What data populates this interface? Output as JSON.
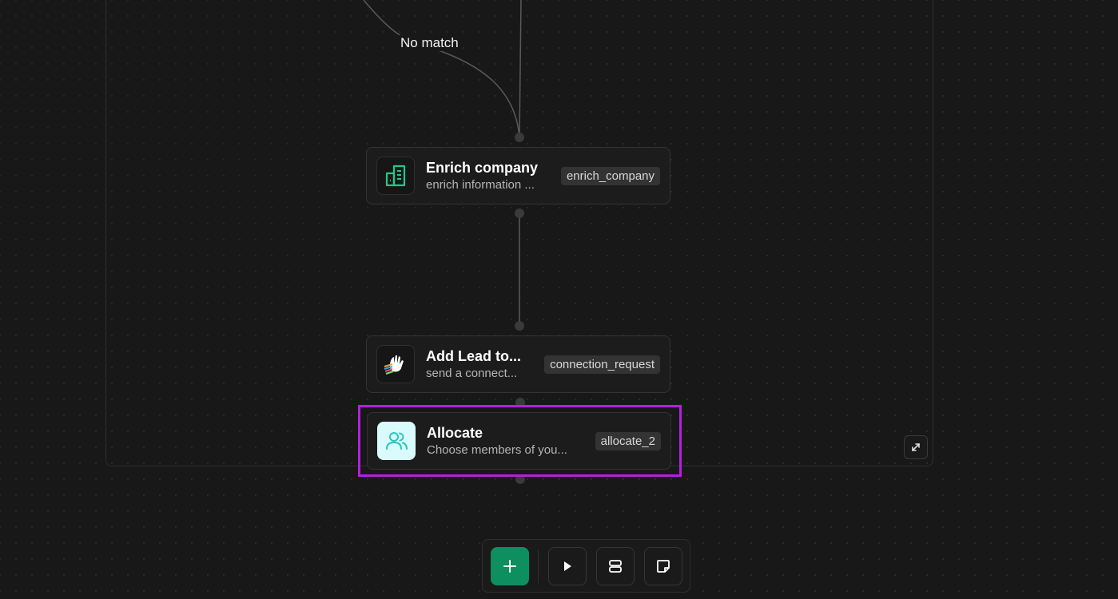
{
  "canvas": {
    "edge_label": "No match"
  },
  "nodes": [
    {
      "title": "Enrich company",
      "subtitle": "enrich information ...",
      "tag": "enrich_company",
      "icon": "building-icon"
    },
    {
      "title": "Add Lead to...",
      "subtitle": "send a connect...",
      "tag": "connection_request",
      "icon": "waving-hand-icon"
    },
    {
      "title": "Allocate",
      "subtitle": "Choose members of you...",
      "tag": "allocate_2",
      "icon": "users-icon",
      "selected": true
    }
  ],
  "toolbar": {
    "buttons": [
      "plus-icon",
      "play-icon",
      "layout-icon",
      "sticky-note-icon"
    ]
  },
  "colors": {
    "background": "#181818",
    "accent_green": "#0d8f60",
    "selection": "#b51fe0",
    "enrich_icon": "#1fc98a",
    "allocate_icon_bg": "#d9fbfb",
    "allocate_icon": "#2cc4c4"
  }
}
